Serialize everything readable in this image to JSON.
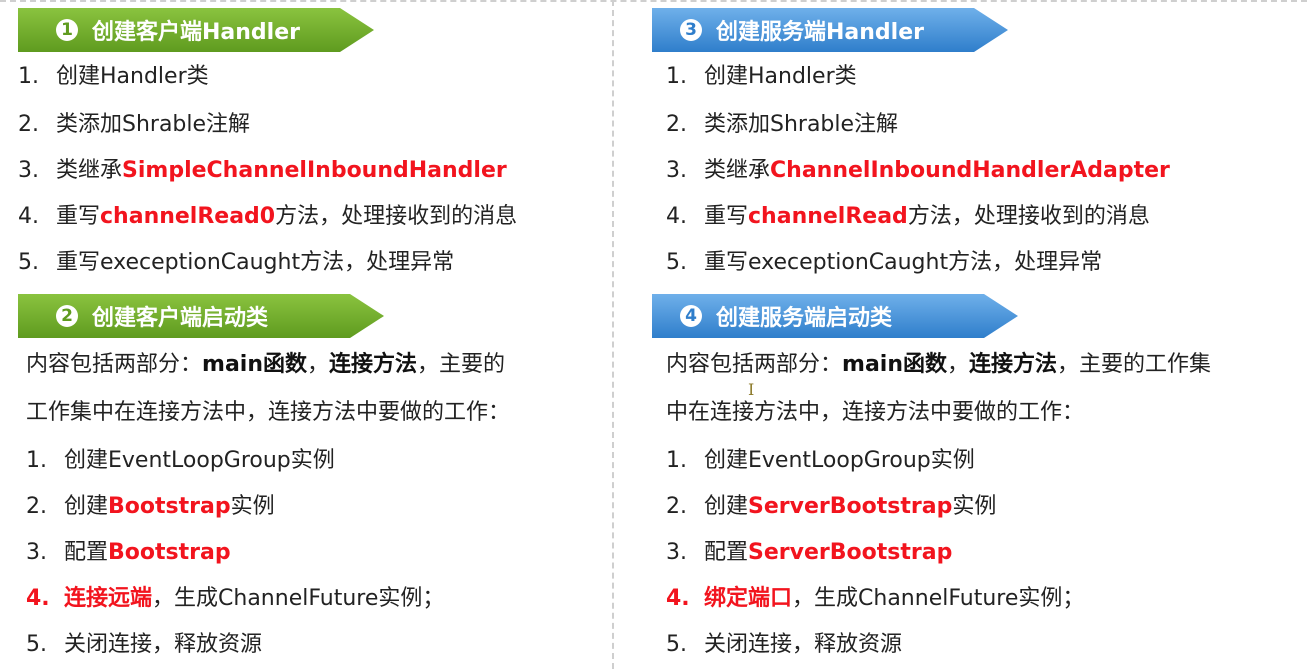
{
  "left": {
    "section1": {
      "number": "1",
      "title": "创建客户端Handler",
      "items": [
        {
          "n": "1.",
          "pre": "创建Handler类",
          "hl": "",
          "post": ""
        },
        {
          "n": "2.",
          "pre": "类添加Shrable注解",
          "hl": "",
          "post": ""
        },
        {
          "n": "3.",
          "pre": "类继承",
          "hl": "SimpleChannelInboundHandler",
          "post": ""
        },
        {
          "n": "4.",
          "pre": "重写",
          "hl": "channelRead0",
          "post": "方法，处理接收到的消息"
        },
        {
          "n": "5.",
          "pre": "重写execeptionCaught方法，处理异常",
          "hl": "",
          "post": ""
        }
      ]
    },
    "section2": {
      "number": "2",
      "title": "创建客户端启动类",
      "intro": {
        "a": "内容包括两部分：",
        "b": "main函数",
        "c": "，",
        "d": "连接方法",
        "e": "，主要的",
        "line2": "工作集中在连接方法中，连接方法中要做的工作："
      },
      "items": [
        {
          "n": "1.",
          "pre": "创建EventLoopGroup实例",
          "hl": "",
          "post": ""
        },
        {
          "n": "2.",
          "pre": "创建",
          "hl": "Bootstrap",
          "post": "实例"
        },
        {
          "n": "3.",
          "pre": "配置",
          "hl": "Bootstrap",
          "post": ""
        },
        {
          "n": "4.",
          "pre": "",
          "hl": "连接远端",
          "post": "，生成ChannelFuture实例；"
        },
        {
          "n": "5.",
          "pre": "关闭连接，释放资源",
          "hl": "",
          "post": ""
        }
      ]
    }
  },
  "right": {
    "section3": {
      "number": "3",
      "title": "创建服务端Handler",
      "items": [
        {
          "n": "1.",
          "pre": "创建Handler类",
          "hl": "",
          "post": ""
        },
        {
          "n": "2.",
          "pre": "类添加Shrable注解",
          "hl": "",
          "post": ""
        },
        {
          "n": "3.",
          "pre": "类继承",
          "hl": "ChannelInboundHandlerAdapter",
          "post": ""
        },
        {
          "n": "4.",
          "pre": "重写",
          "hl": "channelRead",
          "post": "方法，处理接收到的消息"
        },
        {
          "n": "5.",
          "pre": "重写execeptionCaught方法，处理异常",
          "hl": "",
          "post": ""
        }
      ]
    },
    "section4": {
      "number": "4",
      "title": "创建服务端启动类",
      "intro": {
        "a": "内容包括两部分：",
        "b": "main函数",
        "c": "，",
        "d": "连接方法",
        "e": "，主要的工作集",
        "line2": "中在连接方法中，连接方法中要做的工作："
      },
      "items": [
        {
          "n": "1.",
          "pre": "创建EventLoopGroup实例",
          "hl": "",
          "post": ""
        },
        {
          "n": "2.",
          "pre": "创建",
          "hl": "ServerBootstrap",
          "post": "实例"
        },
        {
          "n": "3.",
          "pre": "配置",
          "hl": "ServerBootstrap",
          "post": ""
        },
        {
          "n": "4.",
          "pre": "",
          "hl": "绑定端口",
          "post": "，生成ChannelFuture实例；"
        },
        {
          "n": "5.",
          "pre": "关闭连接，释放资源",
          "hl": "",
          "post": ""
        }
      ]
    }
  },
  "colors": {
    "highlight": "#f2141e",
    "banner_green": "#6fae2a",
    "banner_blue": "#3d8ad6"
  },
  "cursor_glyph": "I"
}
